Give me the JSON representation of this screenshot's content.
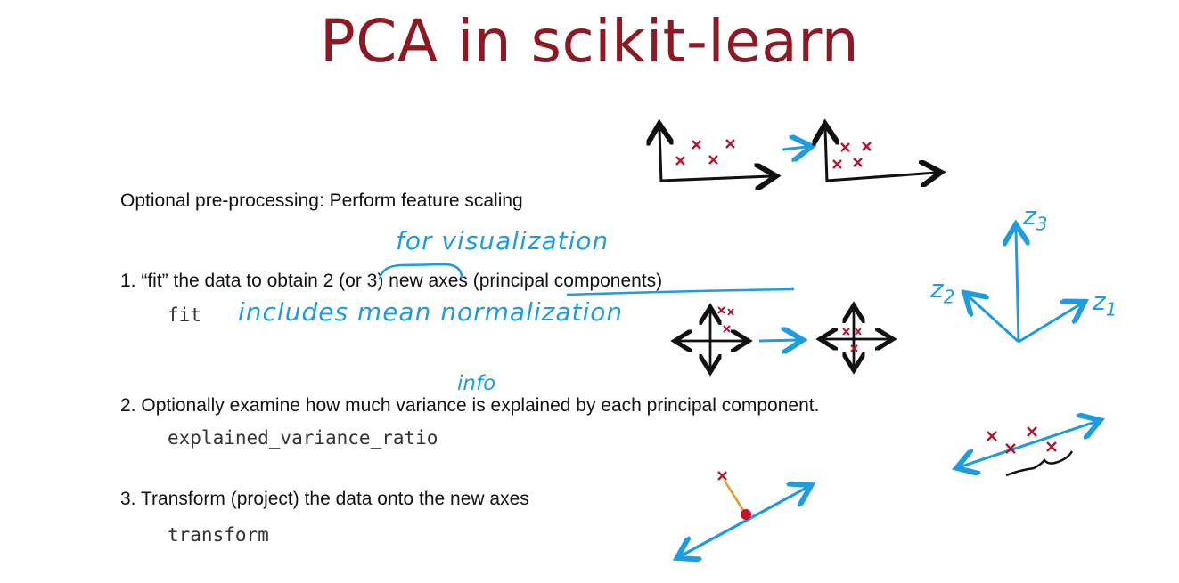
{
  "slide": {
    "title": "PCA in scikit-learn",
    "preprocessing": "Optional pre-processing: Perform feature scaling",
    "step1": {
      "num": "1.",
      "pre": "“fit” the data to obtain ",
      "axes_count": "2 (or 3)",
      "mid": " new axes ",
      "pc": "(principal components)",
      "code": "fit"
    },
    "step2": {
      "num": "2.",
      "text": "Optionally examine how much variance is explained by each principal component.",
      "code": "explained_variance_ratio"
    },
    "step3": {
      "num": "3.",
      "text": "Transform (project) the data onto the new axes",
      "code": "transform"
    }
  },
  "annotations": {
    "for_visualization": "for visualization",
    "includes_mean": "includes mean normalization",
    "info": "info",
    "z1_base": "z",
    "z1_sub": "1",
    "z2_base": "z",
    "z2_sub": "2",
    "z3_base": "z",
    "z3_sub": "3"
  },
  "colors": {
    "title": "#8b1a24",
    "ink_blue": "#1f9be0",
    "ink_red": "#b01830",
    "ink_orange": "#e8961e"
  }
}
